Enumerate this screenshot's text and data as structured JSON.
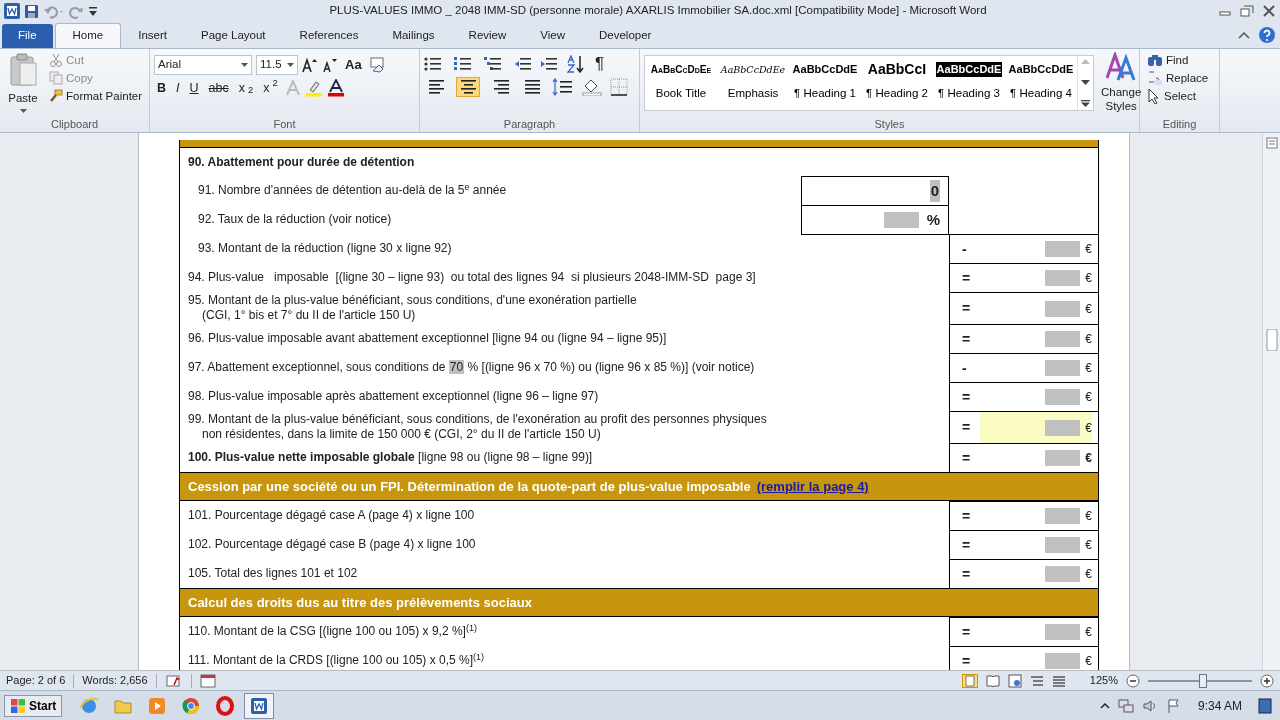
{
  "window": {
    "title": "PLUS-VALUES IMMO _ 2048 IMM-SD (personne morale) AXARLIS Immobilier SA.doc.xml [Compatibility Mode]  -  Microsoft Word"
  },
  "tabs": [
    {
      "label": "File",
      "kind": "file",
      "selected": false
    },
    {
      "label": "Home",
      "kind": "tab",
      "selected": true
    },
    {
      "label": "Insert",
      "kind": "tab",
      "selected": false
    },
    {
      "label": "Page Layout",
      "kind": "tab",
      "selected": false
    },
    {
      "label": "References",
      "kind": "tab",
      "selected": false
    },
    {
      "label": "Mailings",
      "kind": "tab",
      "selected": false
    },
    {
      "label": "Review",
      "kind": "tab",
      "selected": false
    },
    {
      "label": "View",
      "kind": "tab",
      "selected": false
    },
    {
      "label": "Developer",
      "kind": "tab",
      "selected": false
    }
  ],
  "clipboard": {
    "paste": "Paste",
    "cut": "Cut",
    "copy": "Copy",
    "format_painter": "Format Painter",
    "label": "Clipboard"
  },
  "font": {
    "name": "Arial",
    "size": "11.5",
    "case_button": "Aa",
    "format_buttons": [
      "B",
      "I",
      "U",
      "abc",
      "x$_{2}$",
      "x$^{2}$"
    ],
    "label": "Font"
  },
  "paragraph": {
    "alignments": [
      {
        "kind": "left",
        "selected": false
      },
      {
        "kind": "center",
        "selected": true
      },
      {
        "kind": "right",
        "selected": false
      },
      {
        "kind": "justify",
        "selected": false
      }
    ],
    "pilcrow": "¶",
    "label": "Paragraph"
  },
  "styles": {
    "items": [
      {
        "preview": "AaBbCcDdEe",
        "name": "Book Title",
        "kind": "smallcaps",
        "selected": false
      },
      {
        "preview": "AaBbCcDdEe",
        "name": "Emphasis",
        "kind": "italic",
        "selected": false
      },
      {
        "preview": "AaBbCcDdE",
        "name": "¶ Heading 1",
        "kind": "bold",
        "selected": false
      },
      {
        "preview": "AaBbCcI",
        "name": "¶ Heading 2",
        "kind": "large",
        "selected": false
      },
      {
        "preview": "AaBbCcDdE",
        "name": "¶ Heading 3",
        "kind": "bold",
        "selected": true
      },
      {
        "preview": "AaBbCcDdE",
        "name": "¶ Heading 4",
        "kind": "bold",
        "selected": false
      }
    ],
    "change_styles": "Change Styles",
    "label": "Styles"
  },
  "editing": {
    "find": "Find",
    "replace": "Replace",
    "select": "Select",
    "label": "Editing"
  },
  "document": {
    "rows": [
      {
        "kind": "heading",
        "text": "90. Abattement pour durée de détention"
      },
      {
        "kind": "inline",
        "indented": true,
        "text": "91. Nombre d'années de détention au-delà de la 5$^{e}$ année",
        "value": "0"
      },
      {
        "kind": "inline",
        "indented": true,
        "text": "92. Taux de la réduction (voir notice)",
        "unit": "%"
      },
      {
        "kind": "result",
        "indented": true,
        "text": "93. Montant de la réduction (ligne 30 x ligne 92)",
        "operator": "-",
        "currency": "€"
      },
      {
        "kind": "result",
        "text": "94. Plus-value   imposable  [(ligne 30 – ligne 93)  ou total des lignes 94  si plusieurs 2048-IMM-SD  page 3]",
        "operator": "=",
        "currency": "€"
      },
      {
        "kind": "result",
        "text": "95. Montant de la plus-value bénéficiant, sous conditions, d'une exonération partielle",
        "continuation": "(CGI, 1° bis et 7° du II de l'article 150 U)",
        "operator": "=",
        "currency": "€"
      },
      {
        "kind": "result",
        "text": "96. Plus-value imposable avant abattement exceptionnel [ligne 94 ou (ligne 94 – ligne 95)]",
        "operator": "=",
        "currency": "€"
      },
      {
        "kind": "result",
        "text": "97. Abattement exceptionnel, sous conditions de",
        "field": "70",
        "text_after": "% [(ligne 96 x 70 %) ou (ligne 96 x 85 %)] (voir notice)",
        "operator": "-",
        "currency": "€"
      },
      {
        "kind": "result",
        "text": "98. Plus-value imposable après abattement exceptionnel (ligne 96 – ligne 97)",
        "operator": "=",
        "currency": "€"
      },
      {
        "kind": "result",
        "text": "99. Montant de la plus-value bénéficiant, sous conditions, de l'exonération au profit des personnes physiques",
        "continuation": "non résidentes, dans la limite de 150 000 € (CGI, 2° du II de l'article 150 U)",
        "operator": "=",
        "currency": "€",
        "highlighted": true
      },
      {
        "kind": "result",
        "text": "**100. Plus-value nette imposable globale** [ligne 98 ou (ligne 98 – ligne 99)]",
        "operator": "=",
        "currency": "€",
        "strong": true
      },
      {
        "kind": "section",
        "text": "Cession par une société ou un FPI. Détermination de la quote-part de plus-value imposable",
        "link": "(remplir la page 4)"
      },
      {
        "kind": "result",
        "text": "101. Pourcentage dégagé case A (page 4) x ligne 100",
        "operator": "=",
        "currency": "€"
      },
      {
        "kind": "result",
        "text": "102. Pourcentage dégagé case B (page 4) x ligne 100",
        "operator": "=",
        "currency": "€"
      },
      {
        "kind": "result",
        "text": "105. Total des lignes 101 et 102",
        "operator": "=",
        "currency": "€"
      },
      {
        "kind": "section",
        "text": "Calcul des droits dus au titre des prélèvements sociaux"
      },
      {
        "kind": "result",
        "text": "110. Montant de la CSG [(ligne 100 ou 105) x 9,2 %]$^{(1)}$",
        "operator": "=",
        "currency": "€"
      },
      {
        "kind": "result",
        "text": "111. Montant de la CRDS [(ligne 100 ou 105) x 0,5 %]$^{(1)}$",
        "operator": "=",
        "currency": "€"
      }
    ]
  },
  "status_bar": {
    "page": "Page: 2 of 6",
    "words": "Words: 2,656",
    "zoom": "125%",
    "zoom_slider": {
      "level": 0.53
    }
  },
  "taskbar": {
    "start": "Start",
    "time": "9:34 AM"
  }
}
